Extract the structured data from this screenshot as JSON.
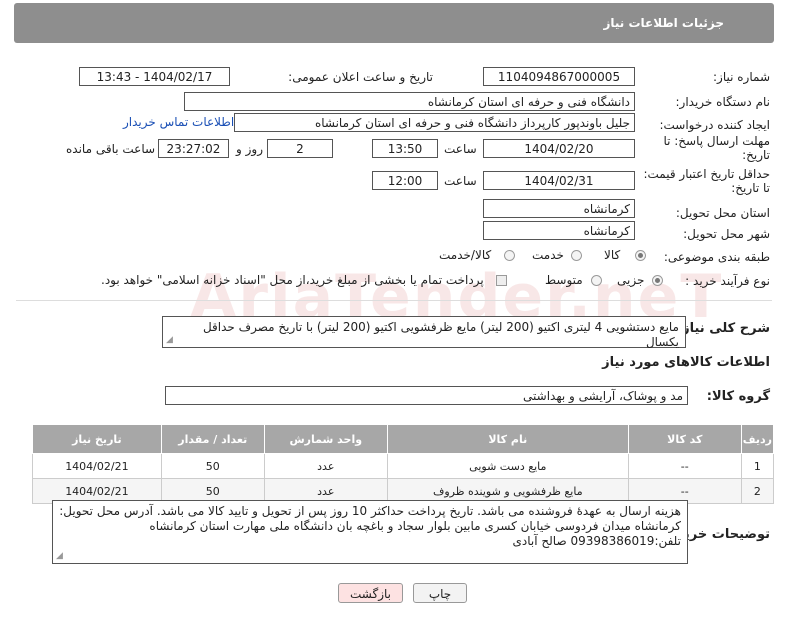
{
  "header": {
    "title": "جزئیات اطلاعات نیاز"
  },
  "fields": {
    "need_number": {
      "label": "شماره نیاز:",
      "value": "1104094867000005"
    },
    "announce_datetime": {
      "label": "تاریخ و ساعت اعلان عمومی:",
      "value": "1404/02/17 - 13:43"
    },
    "buyer_org": {
      "label": "نام دستگاه خریدار:",
      "value": "دانشگاه فنی و حرفه ای استان کرمانشاه"
    },
    "requester": {
      "label": "ایجاد کننده درخواست:",
      "value": "جلیل  باوندپور کارپرداز دانشگاه فنی و حرفه ای استان کرمانشاه",
      "contact_link": "اطلاعات تماس خریدار"
    },
    "reply_deadline": {
      "label_line1": "مهلت ارسال پاسخ: تا",
      "label_line2": "تاریخ:",
      "date": "1404/02/20",
      "time_label": "ساعت",
      "time": "13:50",
      "days": "2",
      "days_label": "روز و",
      "remaining": "23:27:02",
      "remaining_label": "ساعت باقی مانده"
    },
    "price_validity": {
      "label_line1": "حداقل تاریخ اعتبار قیمت:",
      "label_line2": "تا تاریخ:",
      "date": "1404/02/31",
      "time_label": "ساعت",
      "time": "12:00"
    },
    "delivery_province": {
      "label": "استان محل تحویل:",
      "value": "کرمانشاه"
    },
    "delivery_city": {
      "label": "شهر محل تحویل:",
      "value": "کرمانشاه"
    },
    "category": {
      "label": "طبقه بندی موضوعی:",
      "options": [
        "کالا",
        "خدمت",
        "کالا/خدمت"
      ],
      "selected": "کالا"
    },
    "purchase_process": {
      "label": "نوع فرآیند خرید :",
      "options": [
        "جزیی",
        "متوسط"
      ],
      "selected": "جزیی",
      "note": "پرداخت تمام یا بخشی از مبلغ خرید،از محل \"اسناد خزانه اسلامی\" خواهد بود."
    }
  },
  "summary": {
    "label": "شرح کلی نیاز:",
    "value": "مایع دستشویی 4 لیتری اکتیو (200 لیتر) مایع ظرفشویی اکتیو (200 لیتر) با تاریخ مصرف حداقل یکسال"
  },
  "goods_section": {
    "title": "اطلاعات کالاهای مورد نیاز",
    "group_label": "گروه کالا:",
    "group_value": "مد و پوشاک، آرایشی و بهداشتی"
  },
  "table": {
    "columns": [
      "ردیف",
      "کد کالا",
      "نام کالا",
      "واحد شمارش",
      "تعداد / مقدار",
      "تاریخ نیاز"
    ],
    "rows": [
      [
        "1",
        "--",
        "مایع دست شویی",
        "عدد",
        "50",
        "1404/02/21"
      ],
      [
        "2",
        "--",
        "مایع ظرفشویی و شوینده ظروف",
        "عدد",
        "50",
        "1404/02/21"
      ]
    ]
  },
  "buyer_notes": {
    "label": "توضیحات خریدار:",
    "lines": [
      "هزینه ارسال به عهدۀ فروشنده می باشد. تاریخ پرداخت حداکثر 10 روز پس از تحویل و تایید کالا می باشد. آدرس محل تحویل:",
      "کرمانشاه میدان فردوسی خیابان کسری مابین بلوار سجاد و باغچه بان دانشگاه ملی مهارت استان کرمانشاه",
      "تلفن:09398386019 صالح آبادی"
    ]
  },
  "buttons": {
    "print": "چاپ",
    "back": "بازگشت"
  },
  "watermark": {
    "text": "AriaTender.neT"
  },
  "colors": {
    "header_bg": "#8e8e8e",
    "table_header_bg": "#a7a7a7",
    "link": "#1a4fb5",
    "back_button_bg": "#fde2e2"
  }
}
